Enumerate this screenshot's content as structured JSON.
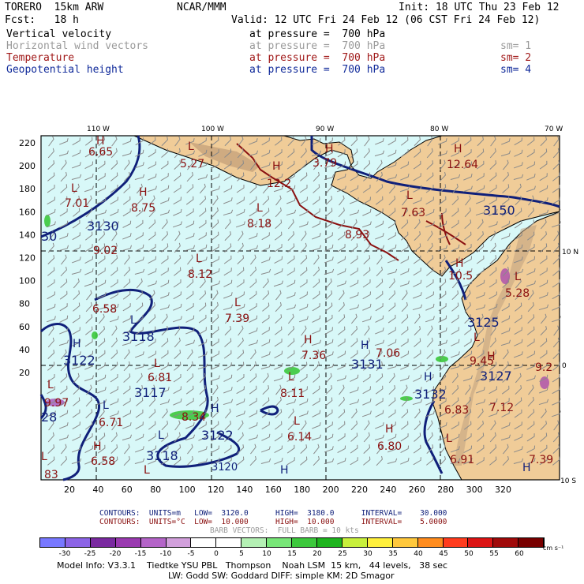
{
  "header": {
    "model": "TORERO  15km ARW",
    "center": "NCAR/MMM",
    "init": "Init: 18 UTC Thu 23 Feb 12",
    "fcst": "Fcst:   18 h",
    "valid": "Valid: 12 UTC Fri 24 Feb 12 (06 CST Fri 24 Feb 12)"
  },
  "fields": [
    {
      "name": "Vertical velocity",
      "level": "at pressure =  700 hPa",
      "sm": "",
      "color": "#000000"
    },
    {
      "name": "Horizontal wind vectors",
      "level": "at pressure =  700 hPa",
      "sm": "sm= 1",
      "color": "#9a9a9a"
    },
    {
      "name": "Temperature",
      "level": "at pressure =  700 hPa",
      "sm": "sm= 2",
      "color": "#a01818"
    },
    {
      "name": "Geopotential height",
      "level": "at pressure =  700 hPa",
      "sm": "sm= 4",
      "color": "#102a9a"
    }
  ],
  "map": {
    "top_lon_labels": [
      "110 W",
      "100 W",
      "90 W",
      "80 W",
      "70 W"
    ],
    "right_lat_labels": [
      "10 N",
      "0",
      "10 S"
    ],
    "left_ticks": [
      "220",
      "200",
      "180",
      "160",
      "140",
      "120",
      "100",
      "80",
      "60",
      "40",
      "20"
    ],
    "bottom_ticks": [
      "20",
      "40",
      "60",
      "80",
      "100",
      "120",
      "140",
      "160",
      "180",
      "200",
      "220",
      "240",
      "260",
      "280",
      "300",
      "320"
    ],
    "height_labels": [
      "3130",
      "30",
      "3118",
      "3122",
      "3117",
      "3122",
      "3118",
      "3120",
      "3131",
      "3132",
      "3125",
      "3127",
      "3150",
      "28"
    ],
    "temp_labels": [
      "6.65",
      "5.27",
      "12.2",
      "3.79",
      "12.64",
      "7.01",
      "8.75",
      "8.18",
      "7.63",
      "8.93",
      "9.02",
      "8.12",
      "10.5",
      "5.28",
      "6.58",
      "7.39",
      "7.36",
      "7.06",
      "6.81",
      "8.11",
      "9.45",
      "9.2",
      "9.97",
      "6.71",
      "8.34",
      "6.14",
      "6.80",
      "6.83",
      "7.12",
      "6.58",
      "6.91",
      "7.39",
      "83"
    ],
    "hi_lo_marks": [
      "H",
      "L",
      "H",
      "H",
      "L",
      "H",
      "L",
      "H",
      "L",
      "L",
      "H",
      "L",
      "L",
      "H",
      "H",
      "L",
      "L",
      "H",
      "L",
      "L",
      "H",
      "L",
      "L",
      "H",
      "L",
      "L",
      "H",
      "H",
      "L",
      "L",
      "H",
      "L",
      "H",
      "H"
    ]
  },
  "contours": {
    "line1": "CONTOURS:  UNITS=m   LOW=  3120.0      HIGH=  3180.0      INTERVAL=    30.000",
    "line2": "CONTOURS:  UNITS=°C  LOW=  10.000      HIGH=  10.000      INTERVAL=    5.0000",
    "line3": "BARB VECTORS:  FULL BARB = 10 kts"
  },
  "colorbar": {
    "labels": [
      "-30",
      "-25",
      "-20",
      "-15",
      "-10",
      "-5",
      "0",
      "5",
      "10",
      "15",
      "20",
      "25",
      "30",
      "35",
      "40",
      "45",
      "50",
      "55",
      "60"
    ],
    "unit": "cm s⁻¹",
    "colors": [
      "#7878ff",
      "#8c64e6",
      "#7a2aa0",
      "#9a3ab0",
      "#b464c8",
      "#d2a0dc",
      "#ffffff",
      "#ffffff",
      "#b4f0b4",
      "#78e678",
      "#3cc83c",
      "#1eb41e",
      "#c8f03c",
      "#fff03c",
      "#ffc83c",
      "#ff8c1e",
      "#ff3c1e",
      "#dc1414",
      "#a00a0a",
      "#780000"
    ]
  },
  "footer": {
    "line1": "Model Info: V3.3.1    Tiedtke YSU PBL   Thompson    Noah LSM  15 km,   44 levels,   38 sec",
    "line2": "LW: Godd SW: Goddard DIFF: simple KM: 2D Smagor"
  },
  "colors": {
    "ocean": "#d8f8f8",
    "land": "#f0cc98",
    "height_contour": "#10207a",
    "temp_contour": "#8a1010",
    "barb": "#8a8a8a",
    "grid": "#000000"
  }
}
